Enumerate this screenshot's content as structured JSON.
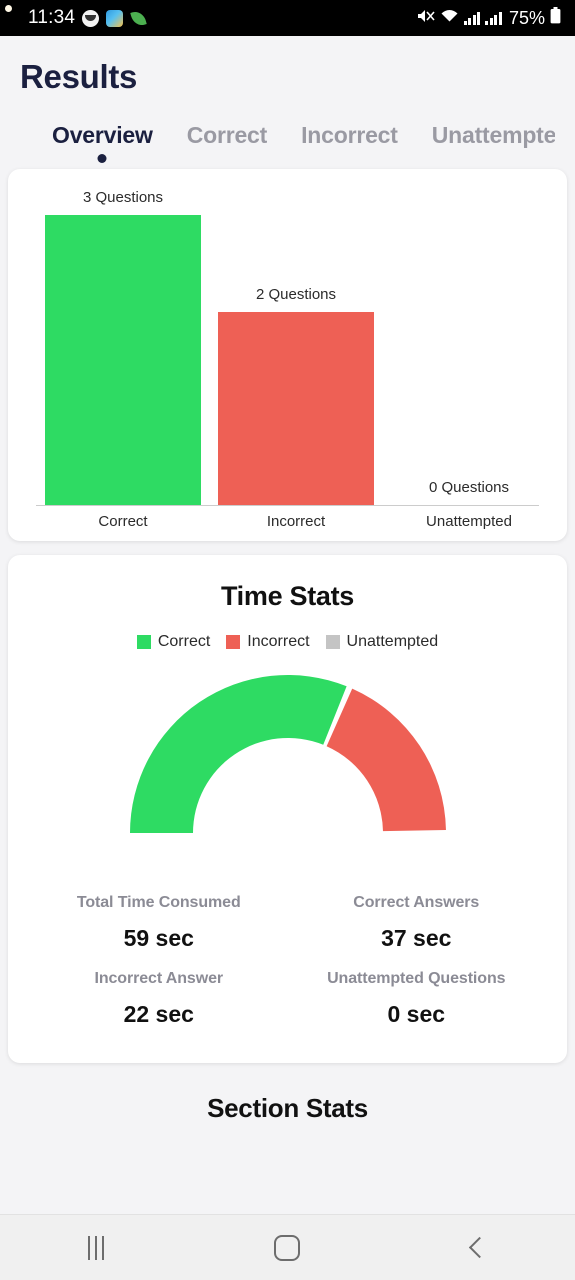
{
  "status_bar": {
    "time": "11:34",
    "battery_percent": "75%",
    "icons": [
      "face-app-icon",
      "photos-app-icon",
      "leaf-app-icon",
      "mute-icon",
      "wifi-icon",
      "signal-icon",
      "signal-icon",
      "battery-icon"
    ]
  },
  "header": {
    "title": "Results"
  },
  "tabs": [
    {
      "label": "Overview",
      "active": true
    },
    {
      "label": "Correct",
      "active": false
    },
    {
      "label": "Incorrect",
      "active": false
    },
    {
      "label": "Unattempted",
      "active": false
    }
  ],
  "colors": {
    "correct": "#2EDB63",
    "incorrect": "#EE6055",
    "unattempted": "#C4C4C4",
    "accent": "#1B2040",
    "background": "#F4F4F6",
    "card": "#FFFFFF"
  },
  "time_stats": {
    "title": "Time Stats",
    "legend": [
      {
        "label": "Correct",
        "color": "#2EDB63"
      },
      {
        "label": "Incorrect",
        "color": "#EE6055"
      },
      {
        "label": "Unattempted",
        "color": "#C4C4C4"
      }
    ],
    "stats": [
      {
        "label": "Total Time Consumed",
        "value": "59 sec"
      },
      {
        "label": "Correct Answers",
        "value": "37 sec"
      },
      {
        "label": "Incorrect Answer",
        "value": "22 sec"
      },
      {
        "label": "Unattempted Questions",
        "value": "0 sec"
      }
    ]
  },
  "section_stats": {
    "title": "Section Stats"
  },
  "nav_bar": {
    "buttons": [
      "recents-button",
      "home-button",
      "back-button"
    ]
  },
  "chart_data": [
    {
      "type": "bar",
      "title": "",
      "categories": [
        "Correct",
        "Incorrect",
        "Unattempted"
      ],
      "values": [
        3,
        2,
        0
      ],
      "data_labels": [
        "3 Questions",
        "2 Questions",
        "0 Questions"
      ],
      "colors": [
        "#2EDB63",
        "#EE6055",
        "#C4C4C4"
      ],
      "xlabel": "",
      "ylabel": "",
      "ylim": [
        0,
        3
      ],
      "grid": false,
      "legend": "none"
    },
    {
      "type": "pie",
      "subtype": "half-donut-gauge",
      "title": "Time Stats",
      "categories": [
        "Correct",
        "Incorrect",
        "Unattempted"
      ],
      "values": [
        37,
        22,
        0
      ],
      "unit": "sec",
      "total": 59,
      "colors": [
        "#2EDB63",
        "#EE6055",
        "#C4C4C4"
      ],
      "legend": "top"
    }
  ]
}
